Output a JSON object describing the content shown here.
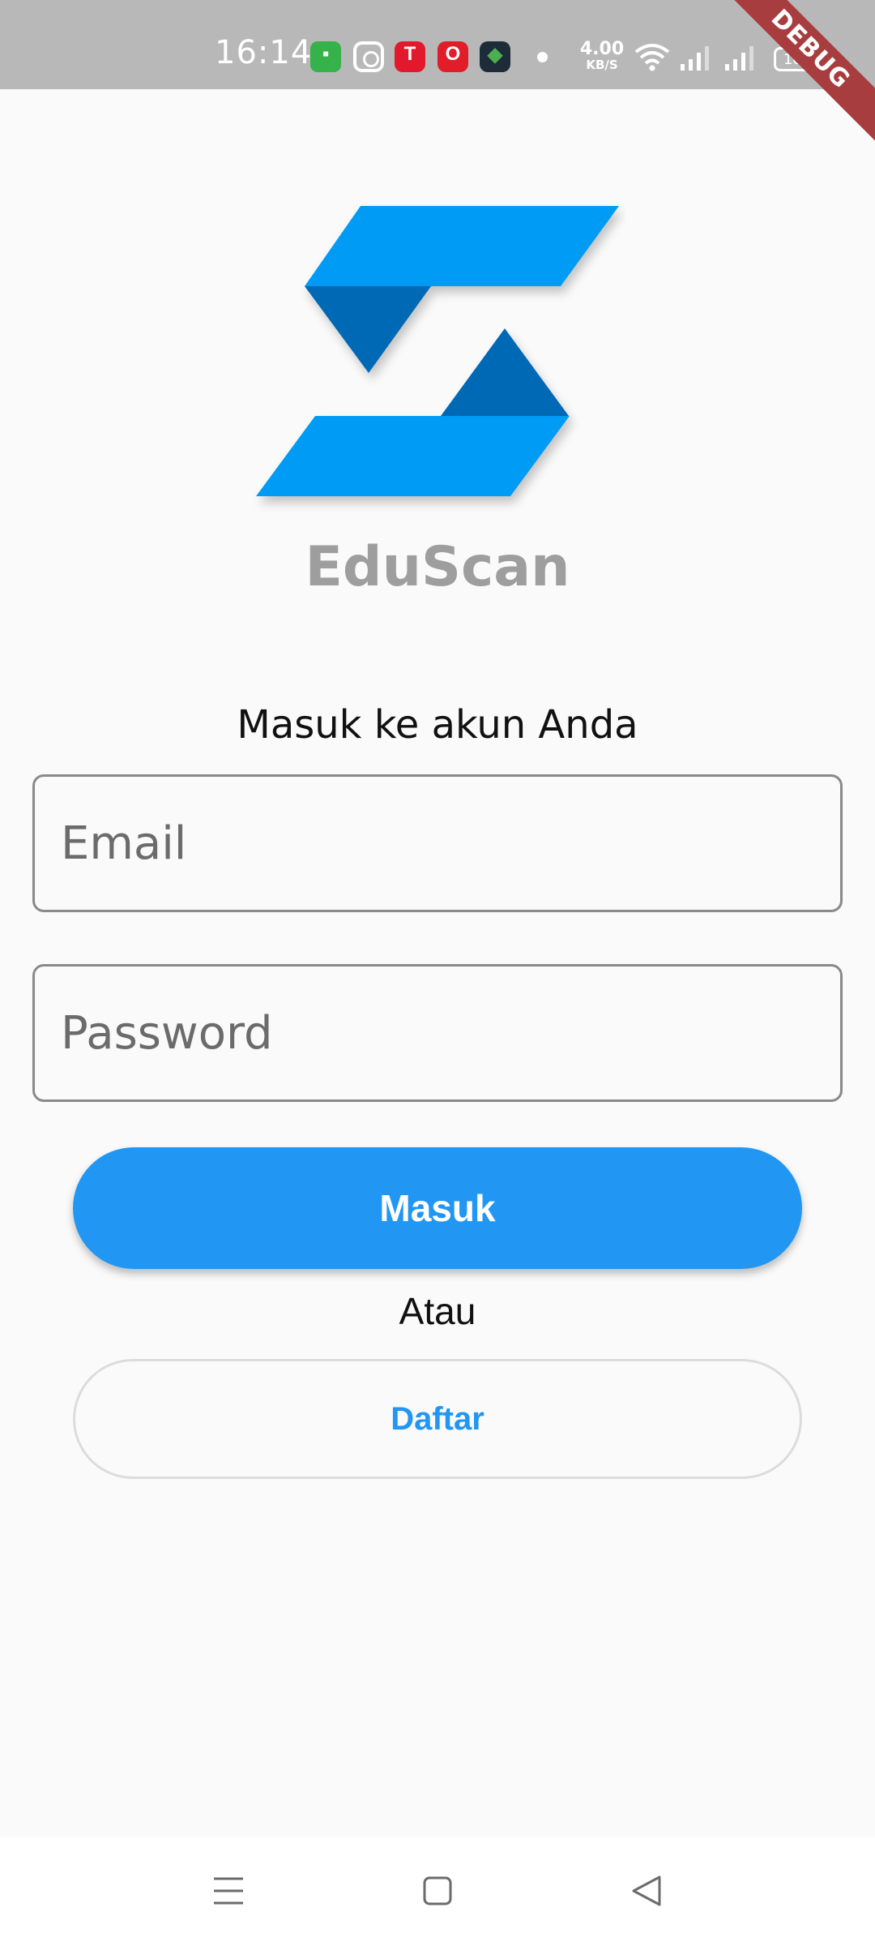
{
  "status_bar": {
    "time": "16:14",
    "net_speed_value": "4.00",
    "net_speed_unit": "KB/S",
    "battery": "100",
    "icons": [
      "green-app-icon",
      "instagram-icon",
      "red-t-app-icon",
      "opera-icon",
      "dark-app-icon",
      "notification-dot",
      "wifi-icon",
      "signal-icon",
      "signal-icon",
      "battery-icon"
    ]
  },
  "debug_banner": "DEBUG",
  "app": {
    "name": "EduScan",
    "logo_colors": {
      "light": "#039BF5",
      "dark": "#0069B5"
    }
  },
  "login": {
    "subtitle": "Masuk ke akun Anda",
    "email_placeholder": "Email",
    "password_placeholder": "Password",
    "login_button": "Masuk",
    "or_text": "Atau",
    "register_button": "Daftar"
  },
  "colors": {
    "primary": "#2196F3",
    "background": "#FAFAFA",
    "status_bar": "#B8B8B8"
  },
  "nav_bar": {
    "buttons": [
      "menu-icon",
      "home-icon",
      "back-icon"
    ]
  }
}
